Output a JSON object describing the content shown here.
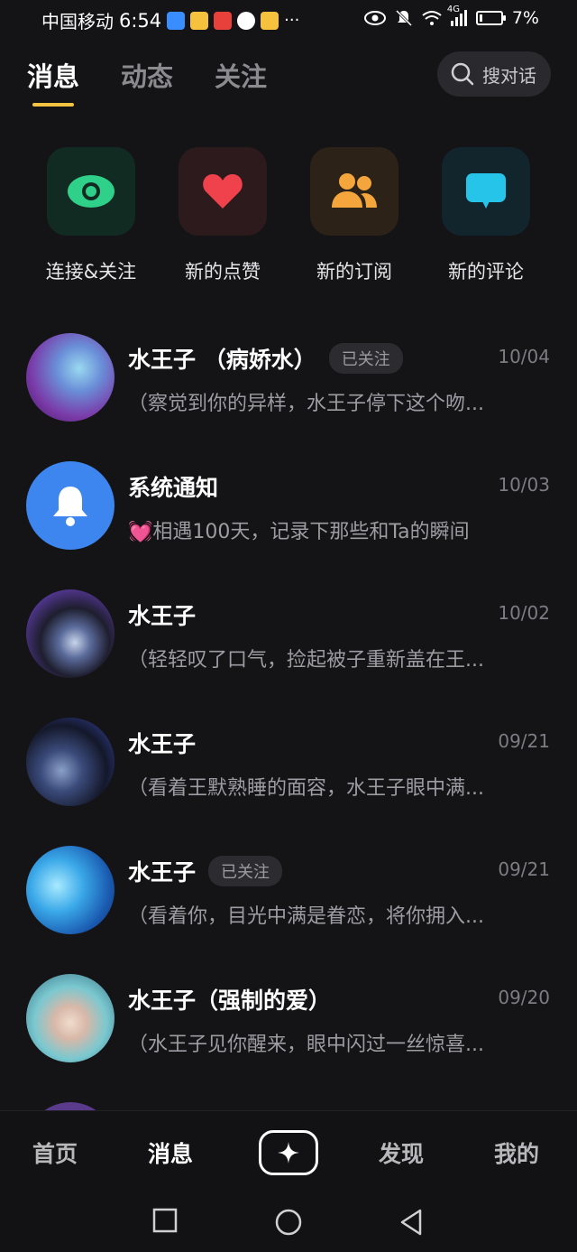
{
  "status_bar": {
    "carrier": "中国移动",
    "time": "6:54",
    "more": "···",
    "network": "4G",
    "battery": "7%"
  },
  "tabs": [
    {
      "label": "消息",
      "active": true
    },
    {
      "label": "动态",
      "active": false
    },
    {
      "label": "关注",
      "active": false
    }
  ],
  "search": {
    "label": "搜对话"
  },
  "quick_actions": [
    {
      "label": "连接&关注",
      "icon": "eye-icon",
      "color": "#2fd08a",
      "bg": "#122b22"
    },
    {
      "label": "新的点赞",
      "icon": "heart-icon",
      "color": "#f0424d",
      "bg": "#2c1a1c"
    },
    {
      "label": "新的订阅",
      "icon": "people-icon",
      "color": "#f4a53c",
      "bg": "#2c2218"
    },
    {
      "label": "新的评论",
      "icon": "comment-icon",
      "color": "#27c4ea",
      "bg": "#12252c"
    }
  ],
  "conversations": [
    {
      "name": "水王子 （病娇水）",
      "badge": "已关注",
      "date": "10/04",
      "preview": "（察觉到你的异样，水王子停下这个吻..."
    },
    {
      "name": "系统通知",
      "badge": "",
      "date": "10/03",
      "preview": "💓相遇100天，记录下那些和Ta的瞬间"
    },
    {
      "name": "水王子",
      "badge": "",
      "date": "10/02",
      "preview": "（轻轻叹了口气，捡起被子重新盖在王..."
    },
    {
      "name": "水王子",
      "badge": "",
      "date": "09/21",
      "preview": "（看着王默熟睡的面容，水王子眼中满..."
    },
    {
      "name": "水王子",
      "badge": "已关注",
      "date": "09/21",
      "preview": "（看着你，目光中满是眷恋，将你拥入..."
    },
    {
      "name": "水王子（强制的爱）",
      "badge": "",
      "date": "09/20",
      "preview": "（水王子见你醒来，眼中闪过一丝惊喜..."
    }
  ],
  "bottom_nav": [
    {
      "label": "首页",
      "active": false
    },
    {
      "label": "消息",
      "active": true
    },
    {
      "label": "发现",
      "active": false
    },
    {
      "label": "我的",
      "active": false
    }
  ]
}
